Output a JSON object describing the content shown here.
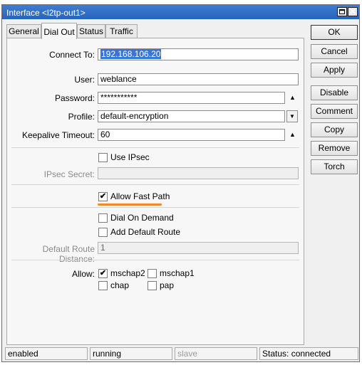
{
  "window": {
    "title": "Interface <l2tp-out1>",
    "max_icon": "maximize-icon",
    "close_icon": "close-icon",
    "close_glyph": "✕"
  },
  "tabs": [
    {
      "label": "General"
    },
    {
      "label": "Dial Out"
    },
    {
      "label": "Status"
    },
    {
      "label": "Traffic"
    }
  ],
  "active_tab": "Dial Out",
  "form": {
    "connect_to": {
      "label": "Connect To:",
      "value": "192.168.106.20"
    },
    "user": {
      "label": "User:",
      "value": "weblance"
    },
    "password": {
      "label": "Password:",
      "value": "***********"
    },
    "profile": {
      "label": "Profile:",
      "value": "default-encryption"
    },
    "keepalive": {
      "label": "Keepalive Timeout:",
      "value": "60"
    },
    "use_ipsec": {
      "label": "Use IPsec",
      "checked": false
    },
    "ipsec_secret": {
      "label": "IPsec Secret:",
      "value": ""
    },
    "allow_fast_path": {
      "label": "Allow Fast Path",
      "checked": true
    },
    "dial_on_demand": {
      "label": "Dial On Demand",
      "checked": false
    },
    "add_default_route": {
      "label": "Add Default Route",
      "checked": false
    },
    "default_route_distance": {
      "label": "Default Route Distance:",
      "value": "1"
    },
    "allow": {
      "label": "Allow:",
      "mschap2": {
        "label": "mschap2",
        "checked": true
      },
      "mschap1": {
        "label": "mschap1",
        "checked": false
      },
      "chap": {
        "label": "chap",
        "checked": false
      },
      "pap": {
        "label": "pap",
        "checked": false
      }
    }
  },
  "glyphs": {
    "up": "▲",
    "dropdown": "▼",
    "check": "✔"
  },
  "buttons": {
    "ok": "OK",
    "cancel": "Cancel",
    "apply": "Apply",
    "disable": "Disable",
    "comment": "Comment",
    "copy": "Copy",
    "remove": "Remove",
    "torch": "Torch"
  },
  "status": {
    "enabled": "enabled",
    "running": "running",
    "slave": "slave",
    "connection": "Status: connected"
  },
  "colors": {
    "title_bar": "#2a63b8",
    "selection": "#3875d7",
    "highlight_underline": "#f08a24"
  }
}
